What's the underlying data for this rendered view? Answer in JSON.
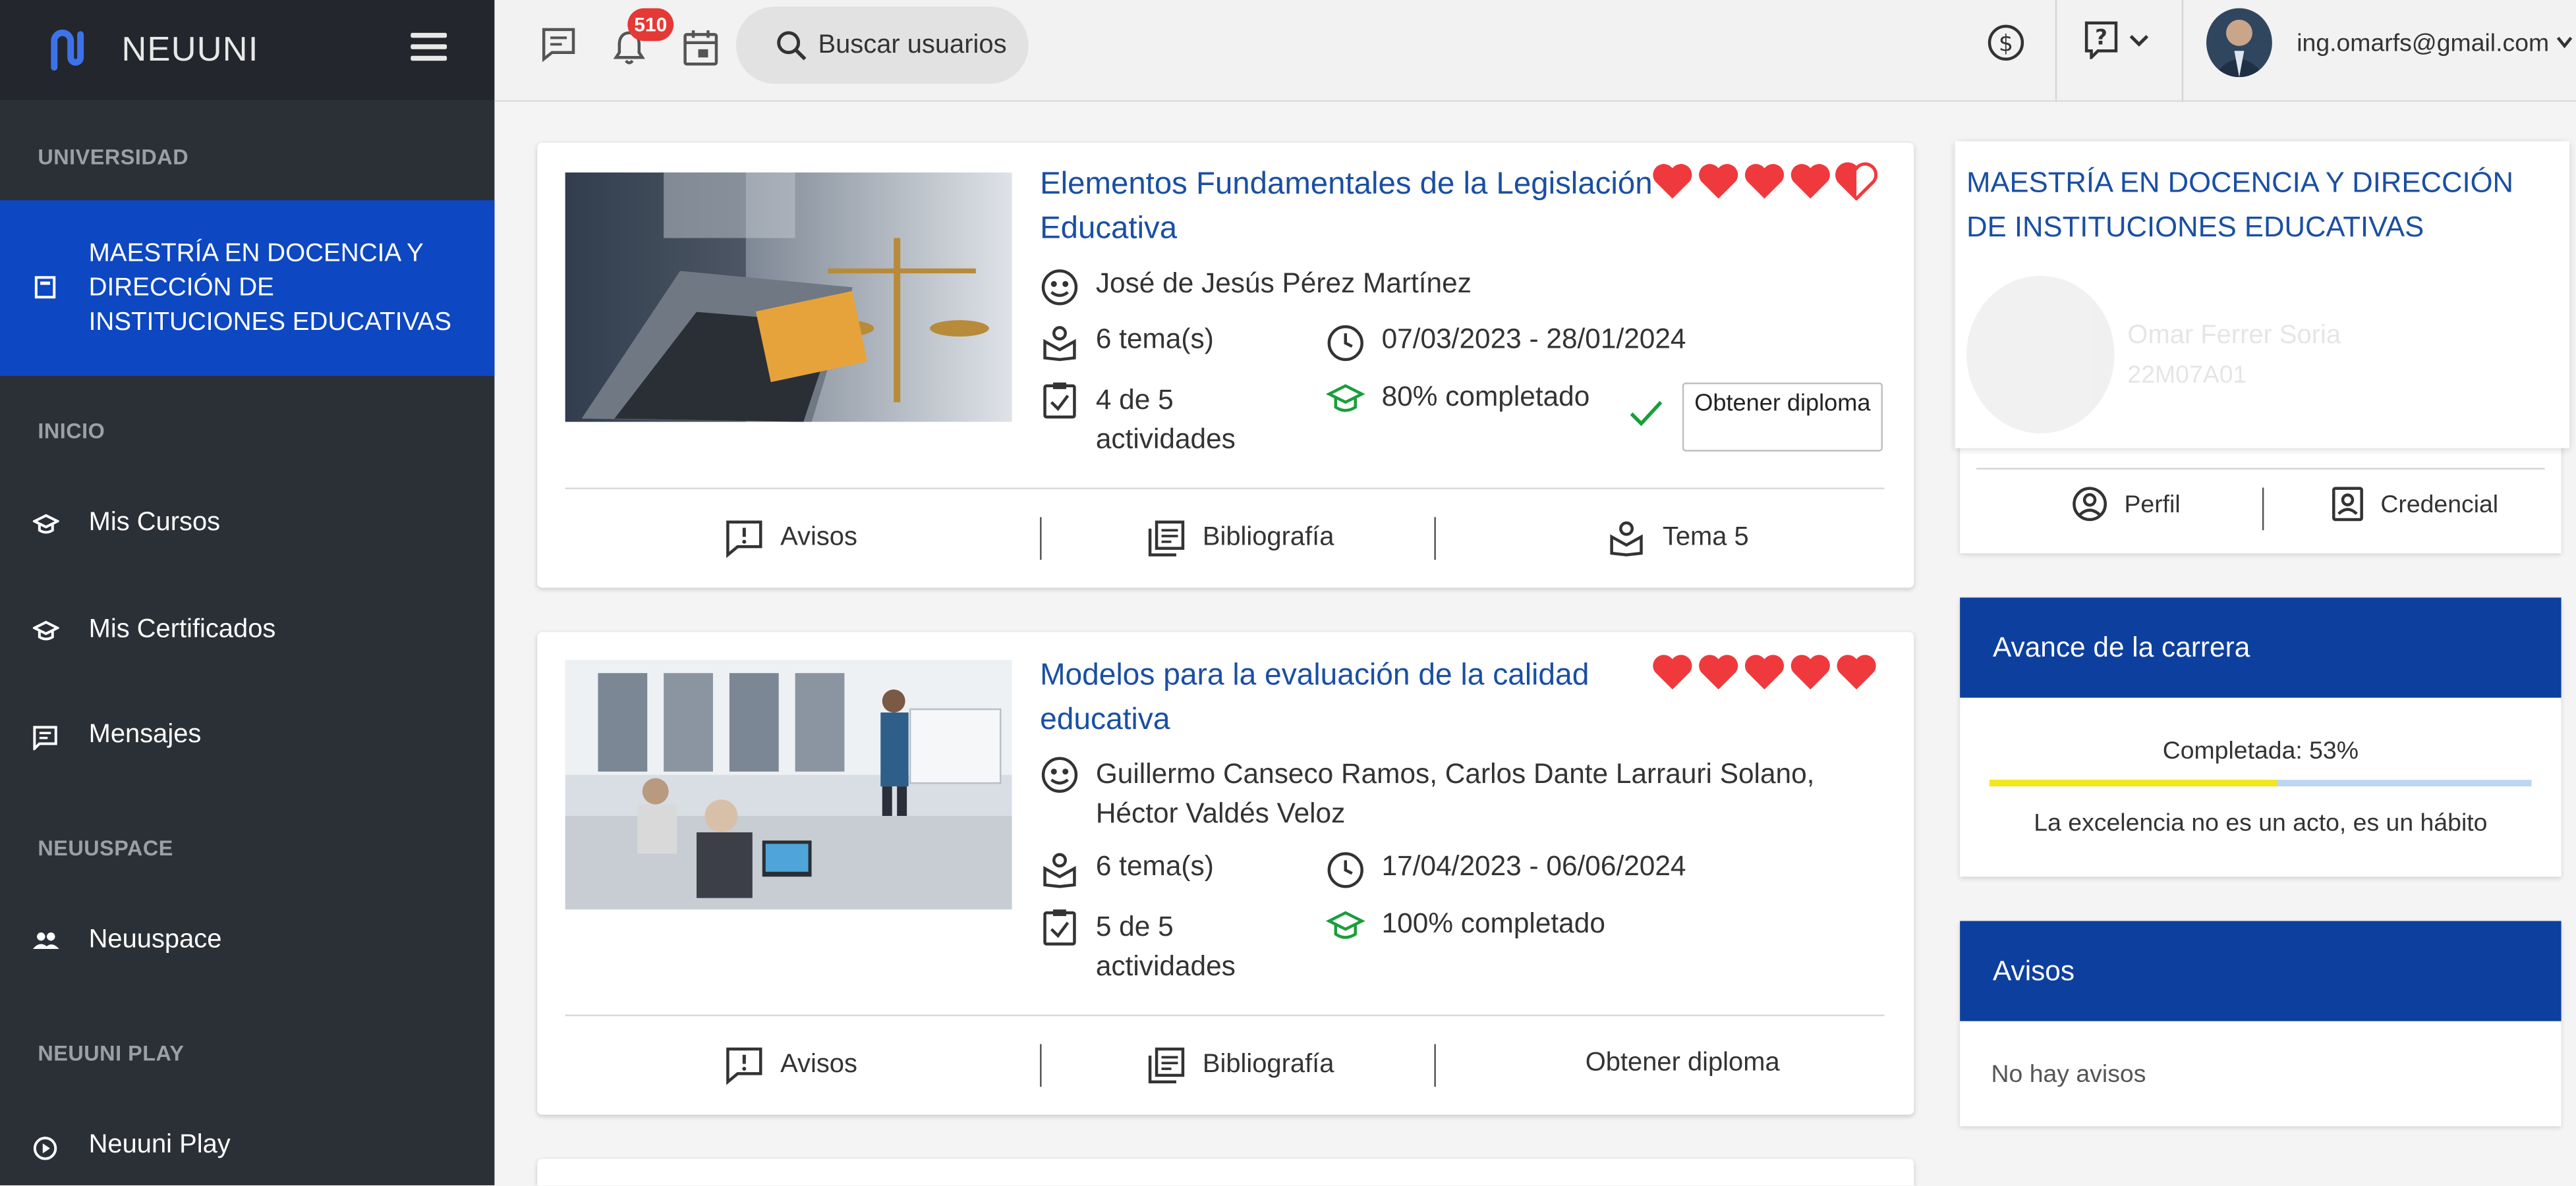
{
  "brand": {
    "name": "NEUUNI"
  },
  "sidebar": {
    "sections": {
      "universidad": "UNIVERSIDAD",
      "inicio": "INICIO",
      "neuuspace": "NEUUSPACE",
      "neuuniplay": "NEUUNI PLAY"
    },
    "active_program": "MAESTRÍA EN DOCENCIA Y DIRECCIÓN DE INSTITUCIONES EDUCATIVAS",
    "items": [
      {
        "label": "Mis Cursos",
        "icon": "graduation-cap-icon"
      },
      {
        "label": "Mis Certificados",
        "icon": "graduation-cap-icon"
      },
      {
        "label": "Mensajes",
        "icon": "message-icon"
      },
      {
        "label": "Neuuspace",
        "icon": "people-icon"
      },
      {
        "label": "Neuuni Play",
        "icon": "play-icon"
      }
    ]
  },
  "topbar": {
    "notifications_count": "510",
    "search_label": "Buscar usuarios",
    "user_email": "ing.omarfs@gmail.com"
  },
  "courses": [
    {
      "title": "Elementos Fundamentales de la Legislación Educativa",
      "rating": 4.5,
      "teacher": "José de Jesús Pérez Martínez",
      "topics": "6 tema(s)",
      "dates": "07/03/2023 - 28/01/2024",
      "activities": "4 de 5 actividades",
      "progress": "80% completado",
      "diploma_button": "Obtener diploma",
      "footer": {
        "avisos": "Avisos",
        "bibliografia": "Bibliografía",
        "tema": "Tema 5"
      }
    },
    {
      "title": "Modelos para la evaluación de la calidad educativa",
      "rating": 5,
      "teacher": "Guillermo Canseco Ramos, Carlos Dante Larrauri Solano, Héctor Valdés Veloz",
      "topics": "6 tema(s)",
      "dates": "17/04/2023 - 06/06/2024",
      "activities": "5 de 5 actividades",
      "progress": "100% completado",
      "footer": {
        "avisos": "Avisos",
        "bibliografia": "Bibliografía",
        "diploma": "Obtener diploma"
      }
    }
  ],
  "profile": {
    "program": "MAESTRÍA EN DOCENCIA Y DIRECCIÓN DE INSTITUCIONES EDUCATIVAS",
    "student_name": "Omar Ferrer Soria",
    "student_id": "22M07A01",
    "perfil_label": "Perfil",
    "credencial_label": "Credencial"
  },
  "career": {
    "heading": "Avance de la carrera",
    "completed_label": "Completada: 53%",
    "progress": 0.53,
    "quote": "La excelencia no es un acto, es un hábito"
  },
  "notices": {
    "heading": "Avisos",
    "empty_text": "No hay avisos"
  },
  "colors": {
    "primary": "#0d47c1",
    "panel_header": "#0d3f9e",
    "heart": "#f0393d",
    "progress_fill": "#f3e619",
    "green": "#1a9e3c"
  }
}
